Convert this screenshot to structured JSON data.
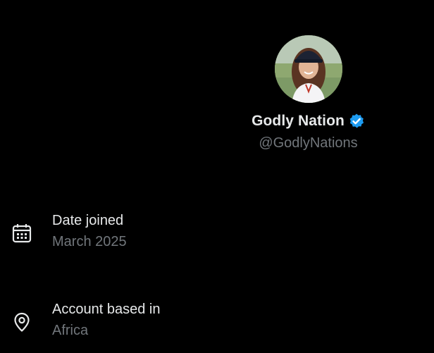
{
  "profile": {
    "display_name": "Godly Nation",
    "handle": "@GodlyNations",
    "verified_color": "#1d9bf0"
  },
  "about": {
    "date_joined": {
      "label": "Date joined",
      "value": "March 2025",
      "icon": "calendar-icon"
    },
    "location": {
      "label": "Account based in",
      "value": "Africa",
      "icon": "location-pin-icon"
    }
  },
  "colors": {
    "background": "#000000",
    "primary_text": "#e7e9ea",
    "secondary_text": "#71767b"
  }
}
